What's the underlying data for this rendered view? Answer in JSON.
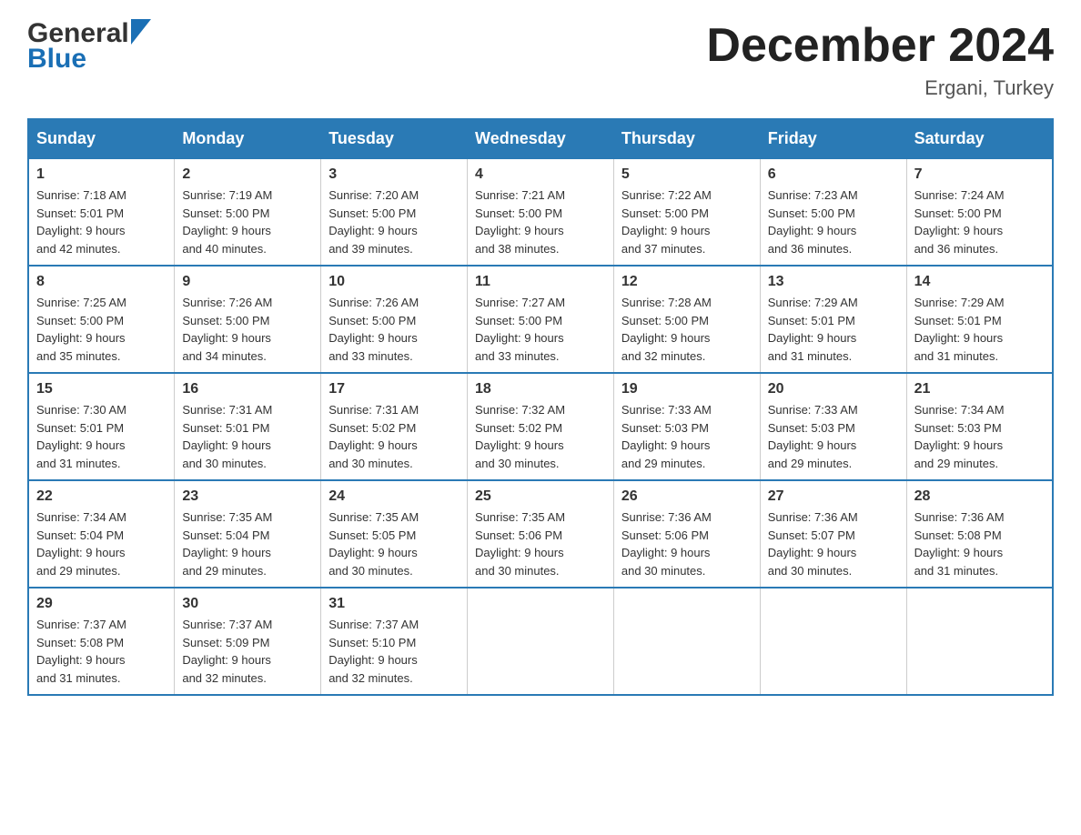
{
  "header": {
    "logo_general": "General",
    "logo_blue": "Blue",
    "month_title": "December 2024",
    "location": "Ergani, Turkey"
  },
  "days_of_week": [
    "Sunday",
    "Monday",
    "Tuesday",
    "Wednesday",
    "Thursday",
    "Friday",
    "Saturday"
  ],
  "weeks": [
    [
      {
        "day": "1",
        "sunrise": "7:18 AM",
        "sunset": "5:01 PM",
        "daylight": "9 hours and 42 minutes."
      },
      {
        "day": "2",
        "sunrise": "7:19 AM",
        "sunset": "5:00 PM",
        "daylight": "9 hours and 40 minutes."
      },
      {
        "day": "3",
        "sunrise": "7:20 AM",
        "sunset": "5:00 PM",
        "daylight": "9 hours and 39 minutes."
      },
      {
        "day": "4",
        "sunrise": "7:21 AM",
        "sunset": "5:00 PM",
        "daylight": "9 hours and 38 minutes."
      },
      {
        "day": "5",
        "sunrise": "7:22 AM",
        "sunset": "5:00 PM",
        "daylight": "9 hours and 37 minutes."
      },
      {
        "day": "6",
        "sunrise": "7:23 AM",
        "sunset": "5:00 PM",
        "daylight": "9 hours and 36 minutes."
      },
      {
        "day": "7",
        "sunrise": "7:24 AM",
        "sunset": "5:00 PM",
        "daylight": "9 hours and 36 minutes."
      }
    ],
    [
      {
        "day": "8",
        "sunrise": "7:25 AM",
        "sunset": "5:00 PM",
        "daylight": "9 hours and 35 minutes."
      },
      {
        "day": "9",
        "sunrise": "7:26 AM",
        "sunset": "5:00 PM",
        "daylight": "9 hours and 34 minutes."
      },
      {
        "day": "10",
        "sunrise": "7:26 AM",
        "sunset": "5:00 PM",
        "daylight": "9 hours and 33 minutes."
      },
      {
        "day": "11",
        "sunrise": "7:27 AM",
        "sunset": "5:00 PM",
        "daylight": "9 hours and 33 minutes."
      },
      {
        "day": "12",
        "sunrise": "7:28 AM",
        "sunset": "5:00 PM",
        "daylight": "9 hours and 32 minutes."
      },
      {
        "day": "13",
        "sunrise": "7:29 AM",
        "sunset": "5:01 PM",
        "daylight": "9 hours and 31 minutes."
      },
      {
        "day": "14",
        "sunrise": "7:29 AM",
        "sunset": "5:01 PM",
        "daylight": "9 hours and 31 minutes."
      }
    ],
    [
      {
        "day": "15",
        "sunrise": "7:30 AM",
        "sunset": "5:01 PM",
        "daylight": "9 hours and 31 minutes."
      },
      {
        "day": "16",
        "sunrise": "7:31 AM",
        "sunset": "5:01 PM",
        "daylight": "9 hours and 30 minutes."
      },
      {
        "day": "17",
        "sunrise": "7:31 AM",
        "sunset": "5:02 PM",
        "daylight": "9 hours and 30 minutes."
      },
      {
        "day": "18",
        "sunrise": "7:32 AM",
        "sunset": "5:02 PM",
        "daylight": "9 hours and 30 minutes."
      },
      {
        "day": "19",
        "sunrise": "7:33 AM",
        "sunset": "5:03 PM",
        "daylight": "9 hours and 29 minutes."
      },
      {
        "day": "20",
        "sunrise": "7:33 AM",
        "sunset": "5:03 PM",
        "daylight": "9 hours and 29 minutes."
      },
      {
        "day": "21",
        "sunrise": "7:34 AM",
        "sunset": "5:03 PM",
        "daylight": "9 hours and 29 minutes."
      }
    ],
    [
      {
        "day": "22",
        "sunrise": "7:34 AM",
        "sunset": "5:04 PM",
        "daylight": "9 hours and 29 minutes."
      },
      {
        "day": "23",
        "sunrise": "7:35 AM",
        "sunset": "5:04 PM",
        "daylight": "9 hours and 29 minutes."
      },
      {
        "day": "24",
        "sunrise": "7:35 AM",
        "sunset": "5:05 PM",
        "daylight": "9 hours and 30 minutes."
      },
      {
        "day": "25",
        "sunrise": "7:35 AM",
        "sunset": "5:06 PM",
        "daylight": "9 hours and 30 minutes."
      },
      {
        "day": "26",
        "sunrise": "7:36 AM",
        "sunset": "5:06 PM",
        "daylight": "9 hours and 30 minutes."
      },
      {
        "day": "27",
        "sunrise": "7:36 AM",
        "sunset": "5:07 PM",
        "daylight": "9 hours and 30 minutes."
      },
      {
        "day": "28",
        "sunrise": "7:36 AM",
        "sunset": "5:08 PM",
        "daylight": "9 hours and 31 minutes."
      }
    ],
    [
      {
        "day": "29",
        "sunrise": "7:37 AM",
        "sunset": "5:08 PM",
        "daylight": "9 hours and 31 minutes."
      },
      {
        "day": "30",
        "sunrise": "7:37 AM",
        "sunset": "5:09 PM",
        "daylight": "9 hours and 32 minutes."
      },
      {
        "day": "31",
        "sunrise": "7:37 AM",
        "sunset": "5:10 PM",
        "daylight": "9 hours and 32 minutes."
      },
      null,
      null,
      null,
      null
    ]
  ],
  "labels": {
    "sunrise": "Sunrise: ",
    "sunset": "Sunset: ",
    "daylight": "Daylight: "
  }
}
